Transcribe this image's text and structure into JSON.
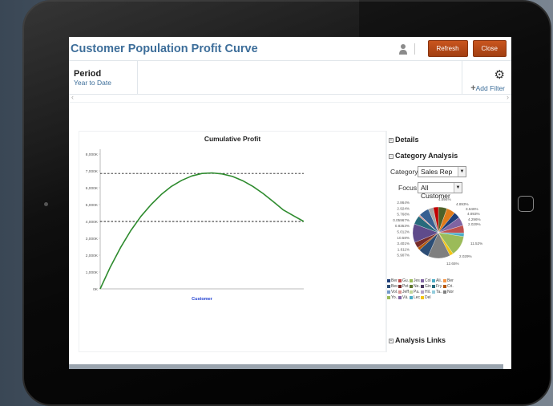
{
  "app": {
    "title": "Customer Population Profit Curve",
    "refresh_label": "Refresh",
    "close_label": "Close"
  },
  "filters": {
    "period_label": "Period",
    "period_value": "Year to Date",
    "add_filter_label": "Add Filter"
  },
  "icons": [
    "user-icon",
    "gear-icon",
    "plus-icon",
    "expand-icon",
    "collapse-icon",
    "chevron-left-icon",
    "chevron-right-icon",
    "dropdown-arrow-icon"
  ],
  "chart_data": {
    "type": "line",
    "title": "Cumulative Profit",
    "xlabel": "Customer",
    "ylabel": "",
    "y_ticks": [
      "0K",
      "1,000K",
      "2,000K",
      "3,000K",
      "4,000K",
      "5,000K",
      "6,000K",
      "7,000K",
      "8,000K"
    ],
    "ylim": [
      0,
      8000
    ],
    "x": [
      0,
      0.05,
      0.1,
      0.15,
      0.2,
      0.25,
      0.3,
      0.35,
      0.4,
      0.45,
      0.5,
      0.55,
      0.6,
      0.65,
      0.7,
      0.75,
      0.8,
      0.85,
      0.9,
      0.95,
      1.0
    ],
    "series": [
      {
        "values": [
          0,
          1300,
          2450,
          3450,
          4300,
          5000,
          5600,
          6080,
          6440,
          6700,
          6850,
          6880,
          6820,
          6670,
          6420,
          6080,
          5660,
          5180,
          4680,
          4340,
          4000
        ]
      }
    ],
    "reference_lines": [
      6850,
      4000
    ],
    "color": "#2e8b2e"
  },
  "side": {
    "details_label": "Details",
    "category_analysis_label": "Category Analysis",
    "category_label": "Category",
    "category_value": "Sales Rep",
    "focus_label": "Focus",
    "focus_value": "All Customer",
    "analysis_links_label": "Analysis Links",
    "pie_labels_left": [
      "2.864%",
      "2.924%",
      "5.768%",
      "0.05967%",
      "0.8353%",
      "5.012%",
      "10.58%",
      "3.401%",
      "1.611%",
      "5.907%"
    ],
    "pie_labels_right": [
      "4.894%",
      "4.893%",
      "3.646%",
      "4.893%",
      "4.296%",
      "2.029%",
      "11.52%",
      "2.029%",
      "12.65%"
    ],
    "pie_values": [
      4.894,
      4.893,
      3.646,
      4.893,
      4.296,
      2.029,
      11.52,
      2.029,
      12.65,
      5.907,
      1.611,
      3.401,
      10.58,
      5.012,
      0.8353,
      0.05967,
      5.768,
      2.924,
      2.864
    ],
    "pie_colors": [
      "#4f6228",
      "#e07b1a",
      "#1f3f79",
      "#8064a2",
      "#c0504d",
      "#4bacc6",
      "#9bbb59",
      "#f2c314",
      "#7f7f7f",
      "#2c4d75",
      "#b65708",
      "#772c2a",
      "#5f4b8b",
      "#276a7c",
      "#d99694",
      "#ffff99",
      "#376092",
      "#a5a5a5",
      "#c00000"
    ],
    "legend": [
      [
        {
          "label": "Ber...",
          "color": "#1f3f79"
        },
        {
          "label": "Gu...",
          "color": "#c0504d"
        },
        {
          "label": "Jes...",
          "color": "#9bbb59"
        },
        {
          "label": "Col...",
          "color": "#8064a2"
        },
        {
          "label": "Ali...",
          "color": "#4bacc6"
        },
        {
          "label": "Ber...",
          "color": "#f79646"
        }
      ],
      [
        {
          "label": "Bes...",
          "color": "#2c4d75"
        },
        {
          "label": "Pet...",
          "color": "#772c2a"
        },
        {
          "label": "Ne...",
          "color": "#5f7530"
        },
        {
          "label": "Gin...",
          "color": "#4d3b62"
        },
        {
          "label": "Fry...",
          "color": "#276a7c"
        },
        {
          "label": "Cri...",
          "color": "#b65708"
        }
      ],
      [
        {
          "label": "Vol...",
          "color": "#729aca"
        },
        {
          "label": "Jeff...",
          "color": "#d99694"
        },
        {
          "label": "Pa...",
          "color": "#c3d69b"
        },
        {
          "label": "Hil...",
          "color": "#b3a2c7"
        },
        {
          "label": "Ta...",
          "color": "#93cddd"
        },
        {
          "label": "None",
          "color": "#7f7f7f"
        }
      ],
      [
        {
          "label": "Yo...",
          "color": "#9bbb59"
        },
        {
          "label": "Vá...",
          "color": "#8064a2"
        },
        {
          "label": "Lec...",
          "color": "#4bacc6"
        },
        {
          "label": "Del...",
          "color": "#f2c314"
        }
      ]
    ]
  }
}
